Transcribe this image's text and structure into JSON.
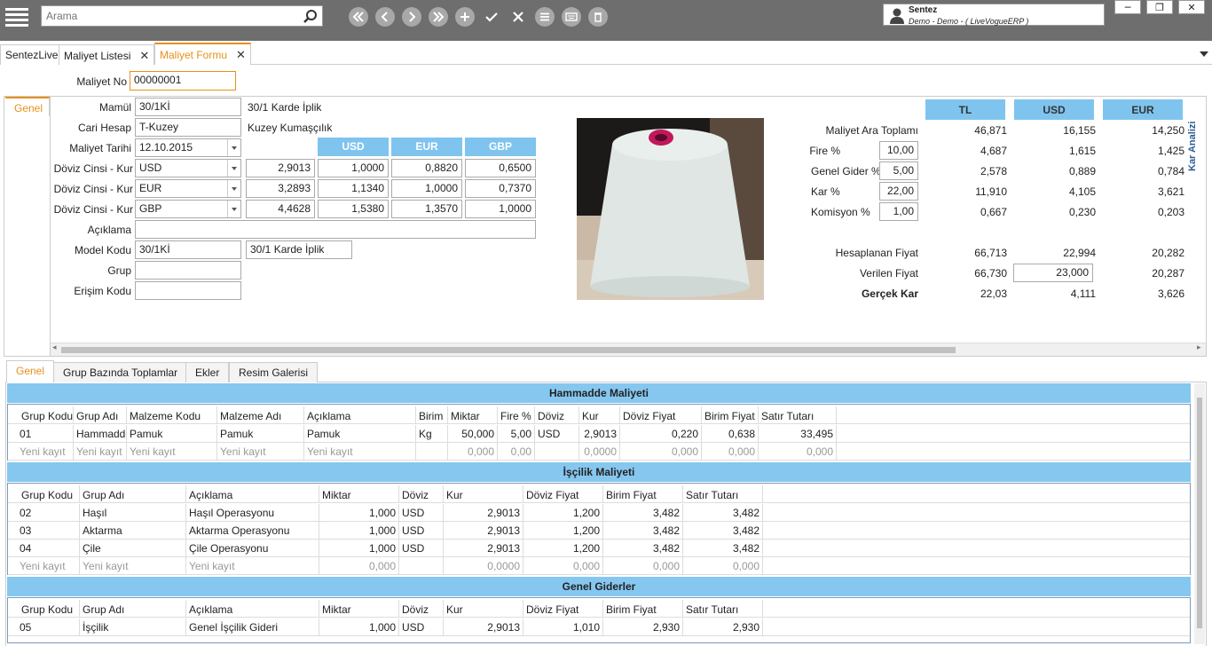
{
  "search": {
    "placeholder": "Arama"
  },
  "user": {
    "name": "Sentez",
    "company": "Demo - Demo - ( LiveVogueERP )"
  },
  "window": {
    "minimize": "─",
    "restore": "❐",
    "close": "✕"
  },
  "tabs": [
    {
      "label": "SentezLive"
    },
    {
      "label": "Maliyet Listesi",
      "close": "✕"
    },
    {
      "label": "Maliyet Formu",
      "close": "✕"
    }
  ],
  "form": {
    "maliyet_no_label": "Maliyet No",
    "maliyet_no": "00000001",
    "side_tab": "Genel",
    "mamul_label": "Mamül",
    "mamul_code": "30/1Kİ",
    "mamul_name": "30/1 Karde İplik",
    "cari_label": "Cari Hesap",
    "cari_code": "T-Kuzey",
    "cari_name": "Kuzey Kumaşçılık",
    "tarih_label": "Maliyet Tarihi",
    "tarih": "12.10.2015",
    "doviz_label": "Döviz Cinsi - Kur",
    "aciklama_label": "Açıklama",
    "aciklama": "",
    "model_label": "Model Kodu",
    "model_code": "30/1Kİ",
    "model_name": "30/1 Karde İplik",
    "grup_label": "Grup",
    "grup": "",
    "erisim_label": "Erişim Kodu",
    "erisim": "",
    "rate_headers": [
      "USD",
      "EUR",
      "GBP"
    ],
    "rates": [
      {
        "cur": "USD",
        "kur": "2,9013",
        "usd": "1,0000",
        "eur": "0,8820",
        "gbp": "0,6500"
      },
      {
        "cur": "EUR",
        "kur": "3,2893",
        "usd": "1,1340",
        "eur": "1,0000",
        "gbp": "0,7370"
      },
      {
        "cur": "GBP",
        "kur": "4,4628",
        "usd": "1,5380",
        "eur": "1,3570",
        "gbp": "1,0000"
      }
    ]
  },
  "analysis": {
    "side_label": "Kar Analizi",
    "headers": [
      "TL",
      "USD",
      "EUR"
    ],
    "ara_toplam_label": "Maliyet Ara Toplamı",
    "ara_toplam": [
      "46,871",
      "16,155",
      "14,250"
    ],
    "fire_label": "Fire %",
    "fire_pct": "10,00",
    "fire": [
      "4,687",
      "1,615",
      "1,425"
    ],
    "genel_label": "Genel Gider %",
    "genel_pct": "5,00",
    "genel": [
      "2,578",
      "0,889",
      "0,784"
    ],
    "kar_label": "Kar %",
    "kar_pct": "22,00",
    "kar": [
      "11,910",
      "4,105",
      "3,621"
    ],
    "komisyon_label": "Komisyon %",
    "komisyon_pct": "1,00",
    "komisyon": [
      "0,667",
      "0,230",
      "0,203"
    ],
    "hesap_label": "Hesaplanan Fiyat",
    "hesap": [
      "66,713",
      "22,994",
      "20,282"
    ],
    "verilen_label": "Verilen Fiyat",
    "verilen": [
      "66,730",
      "23,000",
      "20,287"
    ],
    "gercek_label": "Gerçek Kar",
    "gercek": [
      "22,03",
      "4,111",
      "3,626"
    ]
  },
  "subtabs": [
    "Genel",
    "Grup Bazında Toplamlar",
    "Ekler",
    "Resim Galerisi"
  ],
  "hammadde": {
    "title": "Hammadde Maliyeti",
    "columns": [
      "Grup Kodu",
      "Grup Adı",
      "Malzeme Kodu",
      "Malzeme Adı",
      "Açıklama",
      "Birim",
      "Miktar",
      "Fire %",
      "Döviz",
      "Kur",
      "Döviz Fiyat",
      "Birim Fiyat",
      "Satır Tutarı"
    ],
    "rows": [
      [
        "01",
        "Hammadde",
        "Pamuk",
        "Pamuk",
        "Pamuk",
        "Kg",
        "50,000",
        "5,00",
        "USD",
        "2,9013",
        "0,220",
        "0,638",
        "33,495"
      ]
    ],
    "new_row": [
      "Yeni kayıt",
      "Yeni kayıt",
      "Yeni kayıt",
      "Yeni kayıt",
      "Yeni kayıt",
      "",
      "0,000",
      "0,00",
      "",
      "0,0000",
      "0,000",
      "0,000",
      "0,000"
    ]
  },
  "iscilik": {
    "title": "İşçilik Maliyeti",
    "columns": [
      "Grup Kodu",
      "Grup Adı",
      "Açıklama",
      "Miktar",
      "Döviz",
      "Kur",
      "Döviz Fiyat",
      "Birim Fiyat",
      "Satır Tutarı"
    ],
    "rows": [
      [
        "02",
        "Haşıl",
        "Haşıl Operasyonu",
        "1,000",
        "USD",
        "2,9013",
        "1,200",
        "3,482",
        "3,482"
      ],
      [
        "03",
        "Aktarma",
        "Aktarma Operasyonu",
        "1,000",
        "USD",
        "2,9013",
        "1,200",
        "3,482",
        "3,482"
      ],
      [
        "04",
        "Çile",
        "Çile Operasyonu",
        "1,000",
        "USD",
        "2,9013",
        "1,200",
        "3,482",
        "3,482"
      ]
    ],
    "new_row": [
      "Yeni kayıt",
      "Yeni kayıt",
      "Yeni kayıt",
      "0,000",
      "",
      "0,0000",
      "0,000",
      "0,000",
      "0,000"
    ]
  },
  "genel": {
    "title": "Genel Giderler",
    "columns": [
      "Grup Kodu",
      "Grup Adı",
      "Açıklama",
      "Miktar",
      "Döviz",
      "Kur",
      "Döviz Fiyat",
      "Birim Fiyat",
      "Satır Tutarı"
    ],
    "rows": [
      [
        "05",
        "İşçilik",
        "Genel İşçilik Gideri",
        "1,000",
        "USD",
        "2,9013",
        "1,010",
        "2,930",
        "2,930"
      ]
    ]
  }
}
